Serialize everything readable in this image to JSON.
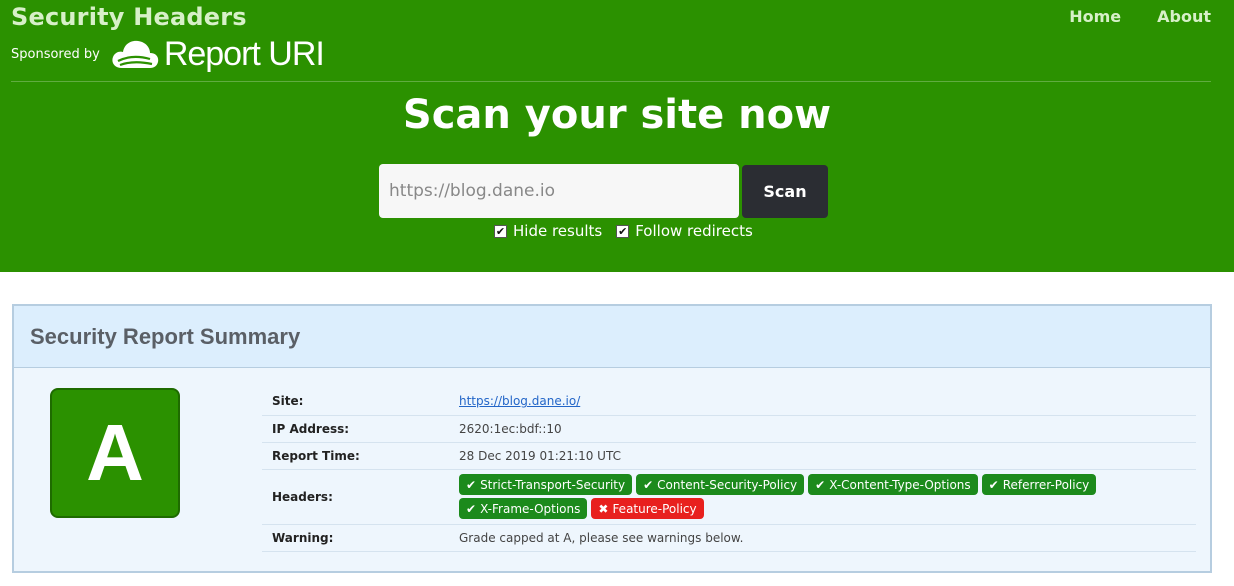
{
  "header": {
    "title": "Security Headers",
    "sponsor_label": "Sponsored by",
    "sponsor_name": "Report URI",
    "nav": [
      {
        "label": "Home"
      },
      {
        "label": "About"
      }
    ]
  },
  "scan": {
    "heading": "Scan your site now",
    "placeholder": "https://blog.dane.io",
    "button_label": "Scan",
    "options": [
      {
        "label": "Hide results",
        "checked": true
      },
      {
        "label": "Follow redirects",
        "checked": true
      }
    ]
  },
  "report": {
    "title": "Security Report Summary",
    "grade": "A",
    "grade_color": "#2b9100",
    "rows": {
      "site": {
        "label": "Site:",
        "value": "https://blog.dane.io/"
      },
      "ip": {
        "label": "IP Address:",
        "value": "2620:1ec:bdf::10"
      },
      "time": {
        "label": "Report Time:",
        "value": "28 Dec 2019 01:21:10 UTC"
      },
      "headers": {
        "label": "Headers:"
      },
      "warning": {
        "label": "Warning:",
        "value": "Grade capped at A, please see warnings below."
      }
    },
    "headers": [
      {
        "name": "Strict-Transport-Security",
        "status": "ok"
      },
      {
        "name": "Content-Security-Policy",
        "status": "ok"
      },
      {
        "name": "X-Content-Type-Options",
        "status": "ok"
      },
      {
        "name": "Referrer-Policy",
        "status": "ok"
      },
      {
        "name": "X-Frame-Options",
        "status": "ok"
      },
      {
        "name": "Feature-Policy",
        "status": "missing"
      }
    ]
  },
  "colors": {
    "brand_green": "#2b9100",
    "pass": "#1c8a1c",
    "fail": "#e8201e"
  }
}
